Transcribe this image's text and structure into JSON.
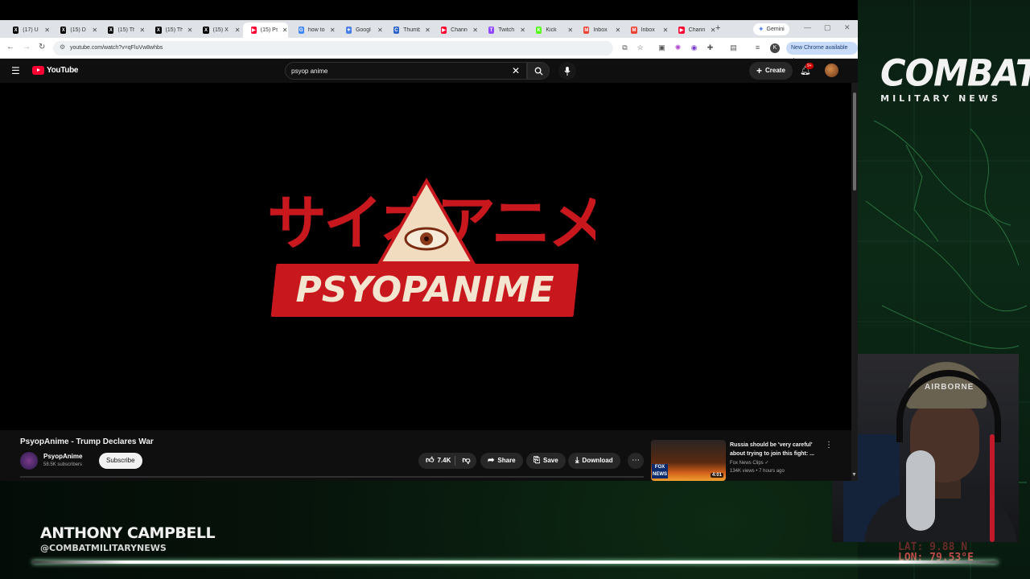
{
  "browser": {
    "tabs": [
      {
        "label": "(17) U",
        "fav": "X",
        "favcolor": "#000000"
      },
      {
        "label": "(15) D",
        "fav": "X",
        "favcolor": "#000000"
      },
      {
        "label": "(15) Th",
        "fav": "X",
        "favcolor": "#000000"
      },
      {
        "label": "(15) Th",
        "fav": "X",
        "favcolor": "#000000"
      },
      {
        "label": "(15) X",
        "fav": "X",
        "favcolor": "#000000"
      },
      {
        "label": "(15) Ps",
        "fav": "▶",
        "favcolor": "#ff0033"
      },
      {
        "label": "how to",
        "fav": "G",
        "favcolor": "#4285f4"
      },
      {
        "label": "Googl",
        "fav": "✦",
        "favcolor": "#4a7fe8"
      },
      {
        "label": "Thumb",
        "fav": "C",
        "favcolor": "#2b63c9"
      },
      {
        "label": "Chann",
        "fav": "▶",
        "favcolor": "#ff0033"
      },
      {
        "label": "Twitch",
        "fav": "T",
        "favcolor": "#9146ff"
      },
      {
        "label": "Kick",
        "fav": "K",
        "favcolor": "#53fc18"
      },
      {
        "label": "Inbox",
        "fav": "M",
        "favcolor": "#ea4335"
      },
      {
        "label": "Inbox",
        "fav": "M",
        "favcolor": "#ea4335"
      },
      {
        "label": "Chann",
        "fav": "▶",
        "favcolor": "#ff0033"
      }
    ],
    "new_tab": "+",
    "gemini_label": "Gemini",
    "url": "youtube.com/watch?v=qFluVw8whbs",
    "profile_initial": "K",
    "update_chip": "New Chrome available ⋮"
  },
  "youtube": {
    "logo_text": "YouTube",
    "search_value": "psyop anime",
    "create_label": "Create",
    "bell_badge": "9+",
    "video": {
      "art_katakana": "サイオアニメ",
      "art_wordmark": "PSYOPANIME",
      "title": "PsyopAnime - Trump Declares War",
      "channel": "PsyopAnime",
      "subscribers": "58.5K subscribers",
      "subscribe_label": "Subscribe",
      "likes": "7.4K",
      "share_label": "Share",
      "save_label": "Save",
      "download_label": "Download"
    },
    "recommendation": {
      "title": "Russia should be 'very careful' about trying to join this fight: ...",
      "channel": "Fox News Clips ✓",
      "meta": "134K views • 7 hours ago",
      "duration": "4:01",
      "badge": "FOX NEWS"
    }
  },
  "overlay": {
    "brand_line1": "COMBAT",
    "brand_line2": "MILITARY NEWS",
    "host_name": "ANTHONY CAMPBELL",
    "host_handle": "@COMBATMILITARYNEWS",
    "coord_lat": "LAT: 9.88 N",
    "coord_lon": "LON:  79.53°E",
    "cap_text": "AIRBORNE"
  }
}
